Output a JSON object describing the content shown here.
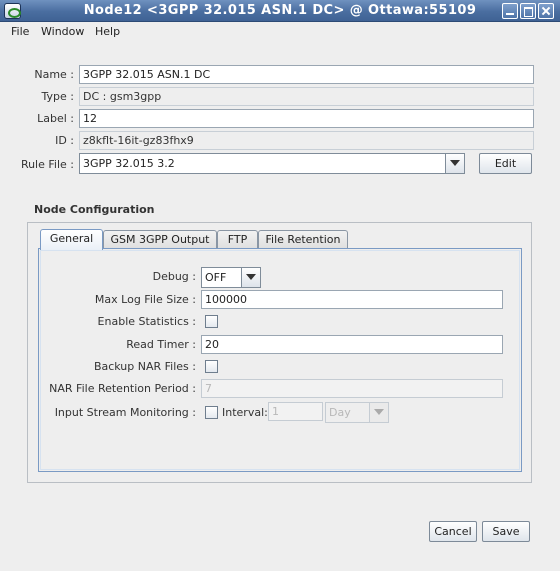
{
  "window": {
    "title": "Node12 <3GPP 32.015 ASN.1 DC> @ Ottawa:55109"
  },
  "menu": {
    "file": "File",
    "window": "Window",
    "help": "Help"
  },
  "form": {
    "name_label": "Name :",
    "name_value": "3GPP 32.015 ASN.1 DC",
    "type_label": "Type :",
    "type_value": "DC : gsm3gpp",
    "label_label": "Label :",
    "label_value": "12",
    "id_label": "ID :",
    "id_value": "z8kflt-16it-gz83fhx9",
    "rule_file_label": "Rule File :",
    "rule_file_value": "3GPP 32.015 3.2",
    "edit_button": "Edit"
  },
  "node_config": {
    "title": "Node Configuration",
    "tabs": [
      {
        "label": "General",
        "active": true
      },
      {
        "label": "GSM 3GPP Output",
        "active": false
      },
      {
        "label": "FTP",
        "active": false
      },
      {
        "label": "File Retention",
        "active": false
      }
    ],
    "general": {
      "debug_label": "Debug :",
      "debug_value": "OFF",
      "max_log_label": "Max Log File Size :",
      "max_log_value": "100000",
      "enable_stats_label": "Enable Statistics :",
      "enable_stats_checked": false,
      "read_timer_label": "Read Timer :",
      "read_timer_value": "20",
      "backup_nar_label": "Backup NAR Files :",
      "backup_nar_checked": false,
      "nar_retention_label": "NAR File Retention Period :",
      "nar_retention_value": "7",
      "input_stream_label": "Input Stream Monitoring :",
      "input_stream_checked": false,
      "interval_label": "Interval:",
      "interval_value": "1",
      "interval_unit": "Day"
    }
  },
  "footer": {
    "cancel_button": "Cancel",
    "save_button": "Save"
  },
  "colors": {
    "titlebar": "#4a6ea0",
    "tab_border": "#7a9ac4",
    "background": "#eeeeee"
  }
}
